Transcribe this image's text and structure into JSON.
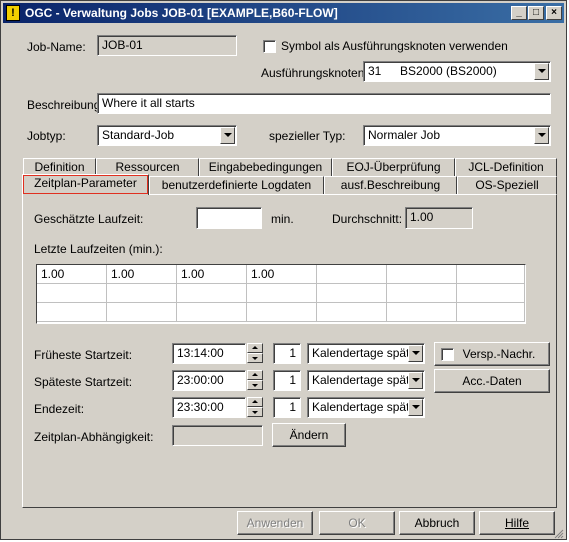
{
  "window": {
    "title": "OGC - Verwaltung Jobs JOB-01 [EXAMPLE,B60-FLOW]",
    "icon_glyph": "!",
    "minimize_glyph": "_",
    "maximize_glyph": "□",
    "close_glyph": "×"
  },
  "form": {
    "job_name_label": "Job-Name:",
    "job_name_value": "JOB-01",
    "symbol_checkbox_label": "Symbol als Ausführungsknoten verwenden",
    "exec_node_label": "Ausführungsknoten:",
    "exec_node_id": "31",
    "exec_node_name": "BS2000 (BS2000)",
    "description_label": "Beschreibung:",
    "description_value": "Where it all starts",
    "jobtype_label": "Jobtyp:",
    "jobtype_value": "Standard-Job",
    "special_type_label": "spezieller Typ:",
    "special_type_value": "Normaler Job"
  },
  "tabs": {
    "row1": [
      "Definition",
      "Ressourcen",
      "Eingabebedingungen",
      "EOJ-Überprüfung",
      "JCL-Definition"
    ],
    "row2": [
      "Zeitplan-Parameter",
      "benutzerdefinierte Logdaten",
      "ausf.Beschreibung",
      "OS-Speziell"
    ],
    "active": "Zeitplan-Parameter"
  },
  "schedule": {
    "est_runtime_label": "Geschätzte Laufzeit:",
    "est_runtime_value": "",
    "est_runtime_unit": "min.",
    "average_label": "Durchschnitt:",
    "average_value": "1.00",
    "last_runtimes_label": "Letzte Laufzeiten (min.):",
    "last_runtimes": [
      [
        "1.00",
        "1.00",
        "1.00",
        "1.00",
        "",
        "",
        ""
      ],
      [
        "",
        "",
        "",
        "",
        "",
        "",
        ""
      ],
      [
        "",
        "",
        "",
        "",
        "",
        "",
        ""
      ]
    ],
    "earliest_label": "Früheste Startzeit:",
    "earliest_time": "13:14:00",
    "earliest_days": "1",
    "earliest_unit": "Kalendertage später",
    "latest_label": "Späteste Startzeit:",
    "latest_time": "23:00:00",
    "latest_days": "1",
    "latest_unit": "Kalendertage später",
    "end_label": "Endezeit:",
    "end_time": "23:30:00",
    "end_days": "1",
    "end_unit": "Kalendertage später",
    "dependency_label": "Zeitplan-Abhängigkeit:",
    "dependency_value": "",
    "change_button": "Ändern",
    "delay_button": "Versp.-Nachr.",
    "acc_button": "Acc.-Daten"
  },
  "footer": {
    "apply": "Anwenden",
    "ok": "OK",
    "cancel": "Abbruch",
    "help": "Hilfe"
  }
}
